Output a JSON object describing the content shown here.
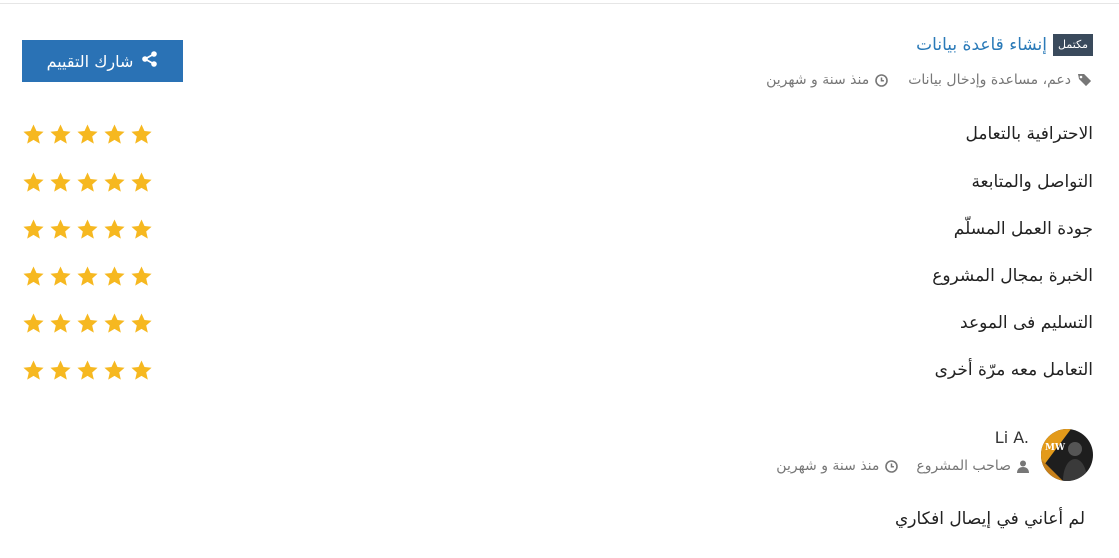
{
  "header": {
    "badge": "مكتمل",
    "project_title": "إنشاء قاعدة بيانات",
    "tags": "دعم، مساعدة وإدخال بيانات",
    "time": "منذ سنة و شهرين"
  },
  "share_button": {
    "label": "شارك التقييم",
    "icon": "share-icon"
  },
  "criteria": [
    {
      "label": "الاحترافية بالتعامل",
      "rating": 5
    },
    {
      "label": "التواصل والمتابعة",
      "rating": 5
    },
    {
      "label": "جودة العمل المسلّم",
      "rating": 5
    },
    {
      "label": "الخبرة بمجال المشروع",
      "rating": 5
    },
    {
      "label": "التسليم فى الموعد",
      "rating": 5
    },
    {
      "label": "التعامل معه مرّة أخرى",
      "rating": 5
    }
  ],
  "author": {
    "name": "Li A.",
    "role": "صاحب المشروع",
    "time": "منذ سنة و شهرين"
  },
  "comment": "لم أعاني في إيصال افكاري",
  "colors": {
    "star": "#f6b820",
    "accent": "#2a72b5",
    "link": "#2a7ab8",
    "badge": "#3a4a5c"
  }
}
